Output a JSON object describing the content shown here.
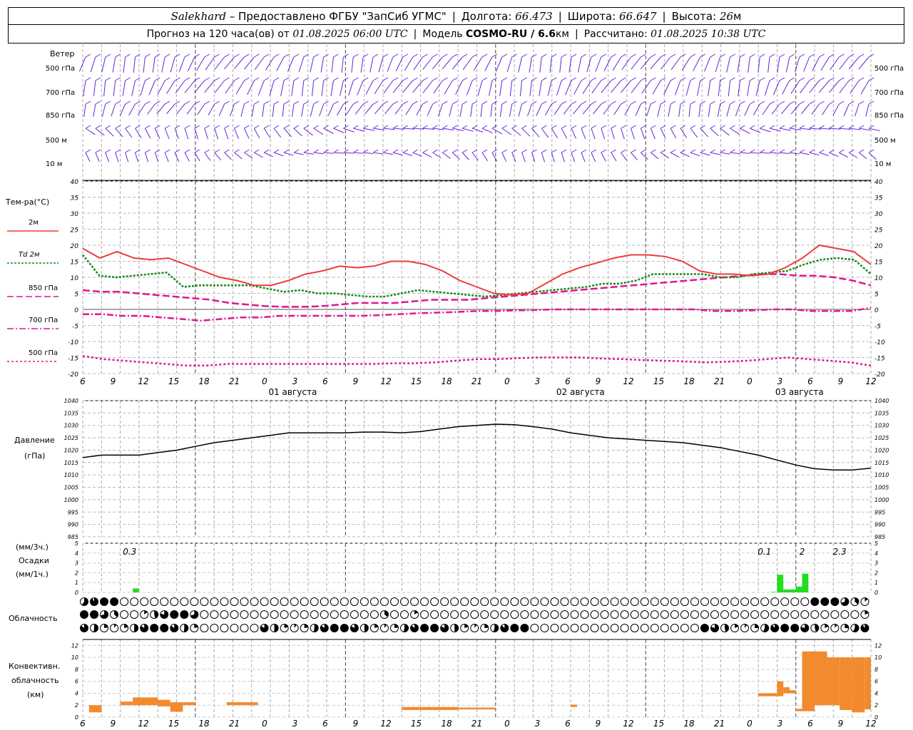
{
  "header": {
    "station": "Salekhard",
    "provider": "– Предоставлено ФГБУ \"ЗапСиб УГМС\"",
    "lon_label": "Долгота:",
    "lon": "66.473",
    "lat_label": "Широта:",
    "lat": "66.647",
    "alt_label": "Высота:",
    "alt": "26",
    "alt_unit": "м",
    "forecast_label": "Прогноз на 120 часа(ов) от",
    "forecast_date": "01.08.2025 06:00 UTC",
    "model_label": "Модель",
    "model": "COSMO-RU / 6.6",
    "model_unit": "км",
    "calc_label": "Рассчитано:",
    "calc_date": "01.08.2025 10:38 UTC"
  },
  "wind_panel": {
    "title": "Ветер",
    "levels": [
      "500 гПа",
      "700 гПа",
      "850 гПа",
      "500 м",
      "10  м"
    ]
  },
  "temp_panel": {
    "title": "Тем-ра(°C)",
    "legend": [
      {
        "label": "2м",
        "color": "#ee3b3b"
      },
      {
        "label": "Td  2м",
        "color": "#1a8a1a"
      },
      {
        "label": "850 гПа",
        "color": "#e0178f"
      },
      {
        "label": "700 гПа",
        "color": "#e0178f"
      },
      {
        "label": "500 гПа",
        "color": "#e0178f"
      }
    ],
    "yticks": [
      "40",
      "35",
      "30",
      "25",
      "20",
      "15",
      "10",
      "5",
      "0",
      "-5",
      "-10",
      "-15",
      "-20"
    ]
  },
  "time_axis": {
    "hour_labels": [
      "6",
      "9",
      "12",
      "15",
      "18",
      "21",
      "0",
      "3",
      "6",
      "9",
      "12",
      "15",
      "18",
      "21",
      "0",
      "3",
      "6",
      "9",
      "12",
      "15",
      "18",
      "21",
      "0",
      "3",
      "6",
      "9",
      "12"
    ],
    "dates": [
      "01 августа",
      "02 августа",
      "03 августа"
    ]
  },
  "pressure_panel": {
    "title1": "Давление",
    "title2": "(гПа)",
    "yticks": [
      "1040",
      "1035",
      "1030",
      "1025",
      "1020",
      "1015",
      "1010",
      "1005",
      "1000",
      "995",
      "990",
      "985"
    ]
  },
  "precip_panel": {
    "label1": "(мм/3ч.)",
    "label2": "Осадки",
    "label3": "(мм/1ч.)",
    "yticks": [
      "5",
      "4",
      "3",
      "2",
      "1",
      "0"
    ],
    "annotations": [
      "0.3",
      "0.1",
      "2",
      "2.3"
    ]
  },
  "cloud_panel": {
    "title": "Облачность"
  },
  "conv_panel": {
    "title1": "Конвективн.",
    "title2": "облачность",
    "title3": "(км)",
    "yticks": [
      "12",
      "10",
      "8",
      "6",
      "4",
      "2",
      "0"
    ]
  },
  "chart_data": {
    "type": "line",
    "x_hours_from_start": [
      0,
      3,
      6,
      9,
      12,
      15,
      18,
      21,
      24,
      27,
      30,
      33,
      36,
      39,
      42,
      45,
      48,
      51,
      54,
      57,
      60,
      63,
      66,
      69,
      72,
      75,
      78,
      81,
      84,
      87,
      90,
      93,
      96,
      99,
      102,
      105,
      108,
      111,
      114,
      117,
      120,
      123,
      126
    ],
    "temp_2m": [
      19,
      16,
      18,
      16,
      15.5,
      16,
      14,
      12,
      10,
      9,
      7.5,
      7.5,
      9,
      11,
      12,
      13.5,
      13,
      13.5,
      15,
      15,
      14,
      12,
      9,
      7,
      5,
      4.5,
      5,
      8,
      11,
      13,
      14.5,
      16,
      17,
      17,
      16.5,
      15,
      12,
      11,
      11,
      10.5,
      11,
      13,
      16,
      20,
      19,
      18,
      14
    ],
    "dewpoint_2m": [
      17,
      10.5,
      10,
      10.5,
      11,
      11.5,
      7,
      7.5,
      7.5,
      7.5,
      7.5,
      6.5,
      5.5,
      6,
      5,
      5,
      4.5,
      4,
      4,
      5,
      6,
      5.5,
      5,
      4.5,
      4,
      4.5,
      5,
      5.5,
      6,
      6.5,
      7,
      8,
      8,
      9,
      11,
      11,
      11,
      11,
      10,
      10,
      11,
      11.5,
      12,
      14,
      15.5,
      16,
      15.5,
      11
    ],
    "t850": [
      6,
      5.5,
      5.5,
      5,
      4.5,
      4,
      3.5,
      3,
      2,
      1.5,
      1,
      0.8,
      0.8,
      1,
      1.5,
      2,
      2,
      2,
      2.5,
      3,
      3,
      3,
      3.5,
      4,
      4.5,
      5,
      5.5,
      6,
      6.5,
      7,
      7.5,
      8,
      8.5,
      9,
      9.5,
      10,
      10.5,
      11,
      11,
      10.5,
      10.5,
      10,
      9,
      7.5
    ],
    "t700": [
      -1.5,
      -1.5,
      -2,
      -2,
      -2.5,
      -3,
      -3.5,
      -3,
      -2.5,
      -2.5,
      -2,
      -2,
      -2,
      -2,
      -2,
      -1.8,
      -1.5,
      -1.2,
      -1,
      -0.8,
      -0.5,
      -0.5,
      -0.3,
      -0.2,
      0,
      0,
      0,
      0,
      0,
      0,
      0,
      0,
      -0.5,
      -0.5,
      -0.3,
      0,
      0,
      -0.5,
      -0.5,
      -0.5,
      0.5
    ],
    "t500": [
      -14.5,
      -15.5,
      -16,
      -16.5,
      -17,
      -17.5,
      -17.5,
      -17,
      -17,
      -17,
      -17,
      -17,
      -17,
      -17,
      -17,
      -16.8,
      -16.8,
      -16.5,
      -16,
      -15.5,
      -15.5,
      -15.2,
      -15,
      -15,
      -15,
      -15.3,
      -15.5,
      -15.8,
      -16,
      -16.2,
      -16.5,
      -16.3,
      -16,
      -15.5,
      -15,
      -15.5,
      -16,
      -16.5,
      -17.5
    ],
    "pressure_hpa": [
      1017,
      1018,
      1018,
      1018,
      1019,
      1020,
      1021.5,
      1023,
      1024,
      1025,
      1026,
      1027,
      1027,
      1027,
      1027,
      1027.3,
      1027.3,
      1027,
      1027.5,
      1028.5,
      1029.5,
      1030,
      1030.5,
      1030.3,
      1029.5,
      1028.5,
      1027,
      1026,
      1025,
      1024.5,
      1024,
      1023.5,
      1023,
      1022,
      1021,
      1019.5,
      1018,
      1016,
      1014,
      1012.5,
      1012,
      1012,
      1012.7
    ],
    "precip_1h": {
      "hours": [
        8,
        110,
        111,
        112,
        113,
        114,
        115,
        116,
        117
      ],
      "values": [
        0.4,
        0.05,
        1.8,
        0.3,
        0.3,
        0.6,
        1.9,
        0,
        0
      ]
    },
    "conv_base_top_km": [
      {
        "h": [
          1,
          3
        ],
        "b": [
          0.8,
          2
        ]
      },
      {
        "h": [
          6,
          8
        ],
        "b": [
          2,
          2.6
        ]
      },
      {
        "h": [
          8,
          12
        ],
        "b": [
          2,
          3.3
        ]
      },
      {
        "h": [
          12,
          14
        ],
        "b": [
          1.8,
          2.9
        ]
      },
      {
        "h": [
          14,
          16
        ],
        "b": [
          0.9,
          2.5
        ]
      },
      {
        "h": [
          16,
          18
        ],
        "b": [
          2,
          2.5
        ]
      },
      {
        "h": [
          23,
          28
        ],
        "b": [
          2,
          2.5
        ]
      },
      {
        "h": [
          51,
          60
        ],
        "b": [
          1.2,
          1.7
        ]
      },
      {
        "h": [
          60,
          66
        ],
        "b": [
          1.3,
          1.6
        ]
      },
      {
        "h": [
          78,
          79
        ],
        "b": [
          1.7,
          2.1
        ]
      },
      {
        "h": [
          108,
          111
        ],
        "b": [
          3.5,
          4.0
        ]
      },
      {
        "h": [
          111,
          112
        ],
        "b": [
          3.5,
          6
        ]
      },
      {
        "h": [
          112,
          113
        ],
        "b": [
          4,
          5
        ]
      },
      {
        "h": [
          113,
          114
        ],
        "b": [
          4,
          4.5
        ]
      },
      {
        "h": [
          114,
          115
        ],
        "b": [
          1,
          1.4
        ]
      },
      {
        "h": [
          115,
          117
        ],
        "b": [
          1,
          11
        ]
      },
      {
        "h": [
          117,
          119
        ],
        "b": [
          2,
          11
        ]
      },
      {
        "h": [
          119,
          121
        ],
        "b": [
          2,
          10
        ]
      },
      {
        "h": [
          121,
          123
        ],
        "b": [
          1.2,
          10
        ]
      },
      {
        "h": [
          123,
          125
        ],
        "b": [
          0.8,
          10
        ]
      },
      {
        "h": [
          125,
          126
        ],
        "b": [
          1.3,
          10
        ]
      }
    ],
    "ylim_temp": [
      -20,
      40
    ],
    "ylim_pressure": [
      985,
      1040
    ],
    "ylim_precip": [
      0,
      5
    ],
    "ylim_conv": [
      0,
      13
    ]
  },
  "colors": {
    "temp_2m": "#ee3b3b",
    "dewpoint": "#1a8a1a",
    "t_levels": "#e0178f",
    "precip": "#22dd22",
    "conv": "#f28a2e",
    "wind": "#6622dd"
  }
}
